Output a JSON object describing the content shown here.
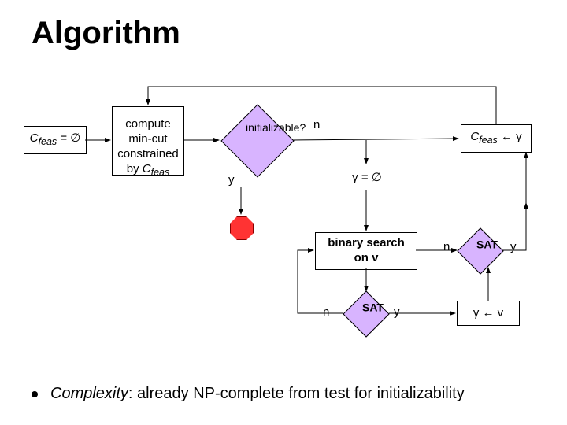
{
  "title": "Algorithm",
  "nodes": {
    "init_cfeas": "C",
    "init_cfeas_sub": "feas",
    "init_cfeas_tail": " = ∅",
    "compute": "compute\nmin-cut\nconstrained\nby ",
    "compute_var": "C",
    "compute_sub": "feas",
    "initializable": "initializable?",
    "gamma_init": "γ = ∅",
    "cfeas_update": "C",
    "cfeas_update_sub": "feas",
    "cfeas_update_tail": " ← γ",
    "binary_search": "binary search\non v",
    "sat1": "SAT",
    "sat2": "SAT",
    "gamma_v": "γ ← v"
  },
  "edge_labels": {
    "init_n": "n",
    "init_y": "y",
    "sat1_n": "n",
    "sat1_y": "y",
    "sat2_n": "n",
    "sat2_y": "y"
  },
  "footer": {
    "pre": "Complexity",
    "post": ": already NP-complete from test for initializability"
  }
}
